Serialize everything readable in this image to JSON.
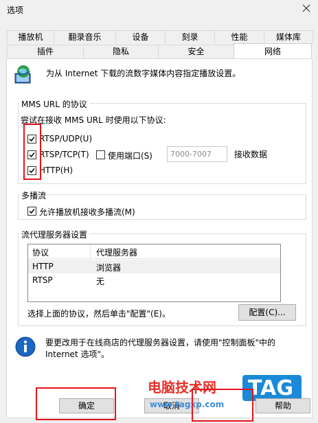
{
  "window": {
    "title": "选项"
  },
  "tabs_row1": [
    "播放机",
    "翻录音乐",
    "设备",
    "刻录",
    "性能",
    "媒体库"
  ],
  "tabs_row2": [
    "插件",
    "隐私",
    "安全",
    "网络"
  ],
  "active_tab": "网络",
  "intro": {
    "text": "为从 Internet 下载的流数字媒体内容指定播放设置。"
  },
  "mms": {
    "legend": "MMS URL 的协议",
    "prompt": "尝试在接收 MMS URL 时使用以下协议:",
    "rtsp_udp": "RTSP/UDP(U)",
    "rtsp_tcp": "RTSP/TCP(T)",
    "http": "HTTP(H)",
    "use_port": "使用端口(S)",
    "port_placeholder": "7000-7007",
    "receive_data": "接收数据"
  },
  "multicast": {
    "legend": "多播流",
    "allow": "允许播放机接收多播流(M)"
  },
  "proxy": {
    "legend": "流代理服务器设置",
    "col_protocol": "协议",
    "col_proxy": "代理服务器",
    "rows": [
      {
        "protocol": "HTTP",
        "proxy": "浏览器"
      },
      {
        "protocol": "RTSP",
        "proxy": "无"
      }
    ],
    "hint": "选择上面的协议，然后单击\"配置\"(E)。",
    "config_button": "配置(C)..."
  },
  "info": {
    "line1": "要更改用于在线商店的代理服务器设置，请使用\"控制面板\"中的",
    "line2": "Internet 选项\"。"
  },
  "footer": {
    "ok": "确定",
    "cancel": "取消",
    "help": "帮助"
  },
  "watermark": {
    "brand": "电脑技术网",
    "url": "www.tagxp.com",
    "tag": "TAG"
  },
  "colors": {
    "highlight": "#e8141b",
    "tag_blue": "#1a8ad8"
  }
}
